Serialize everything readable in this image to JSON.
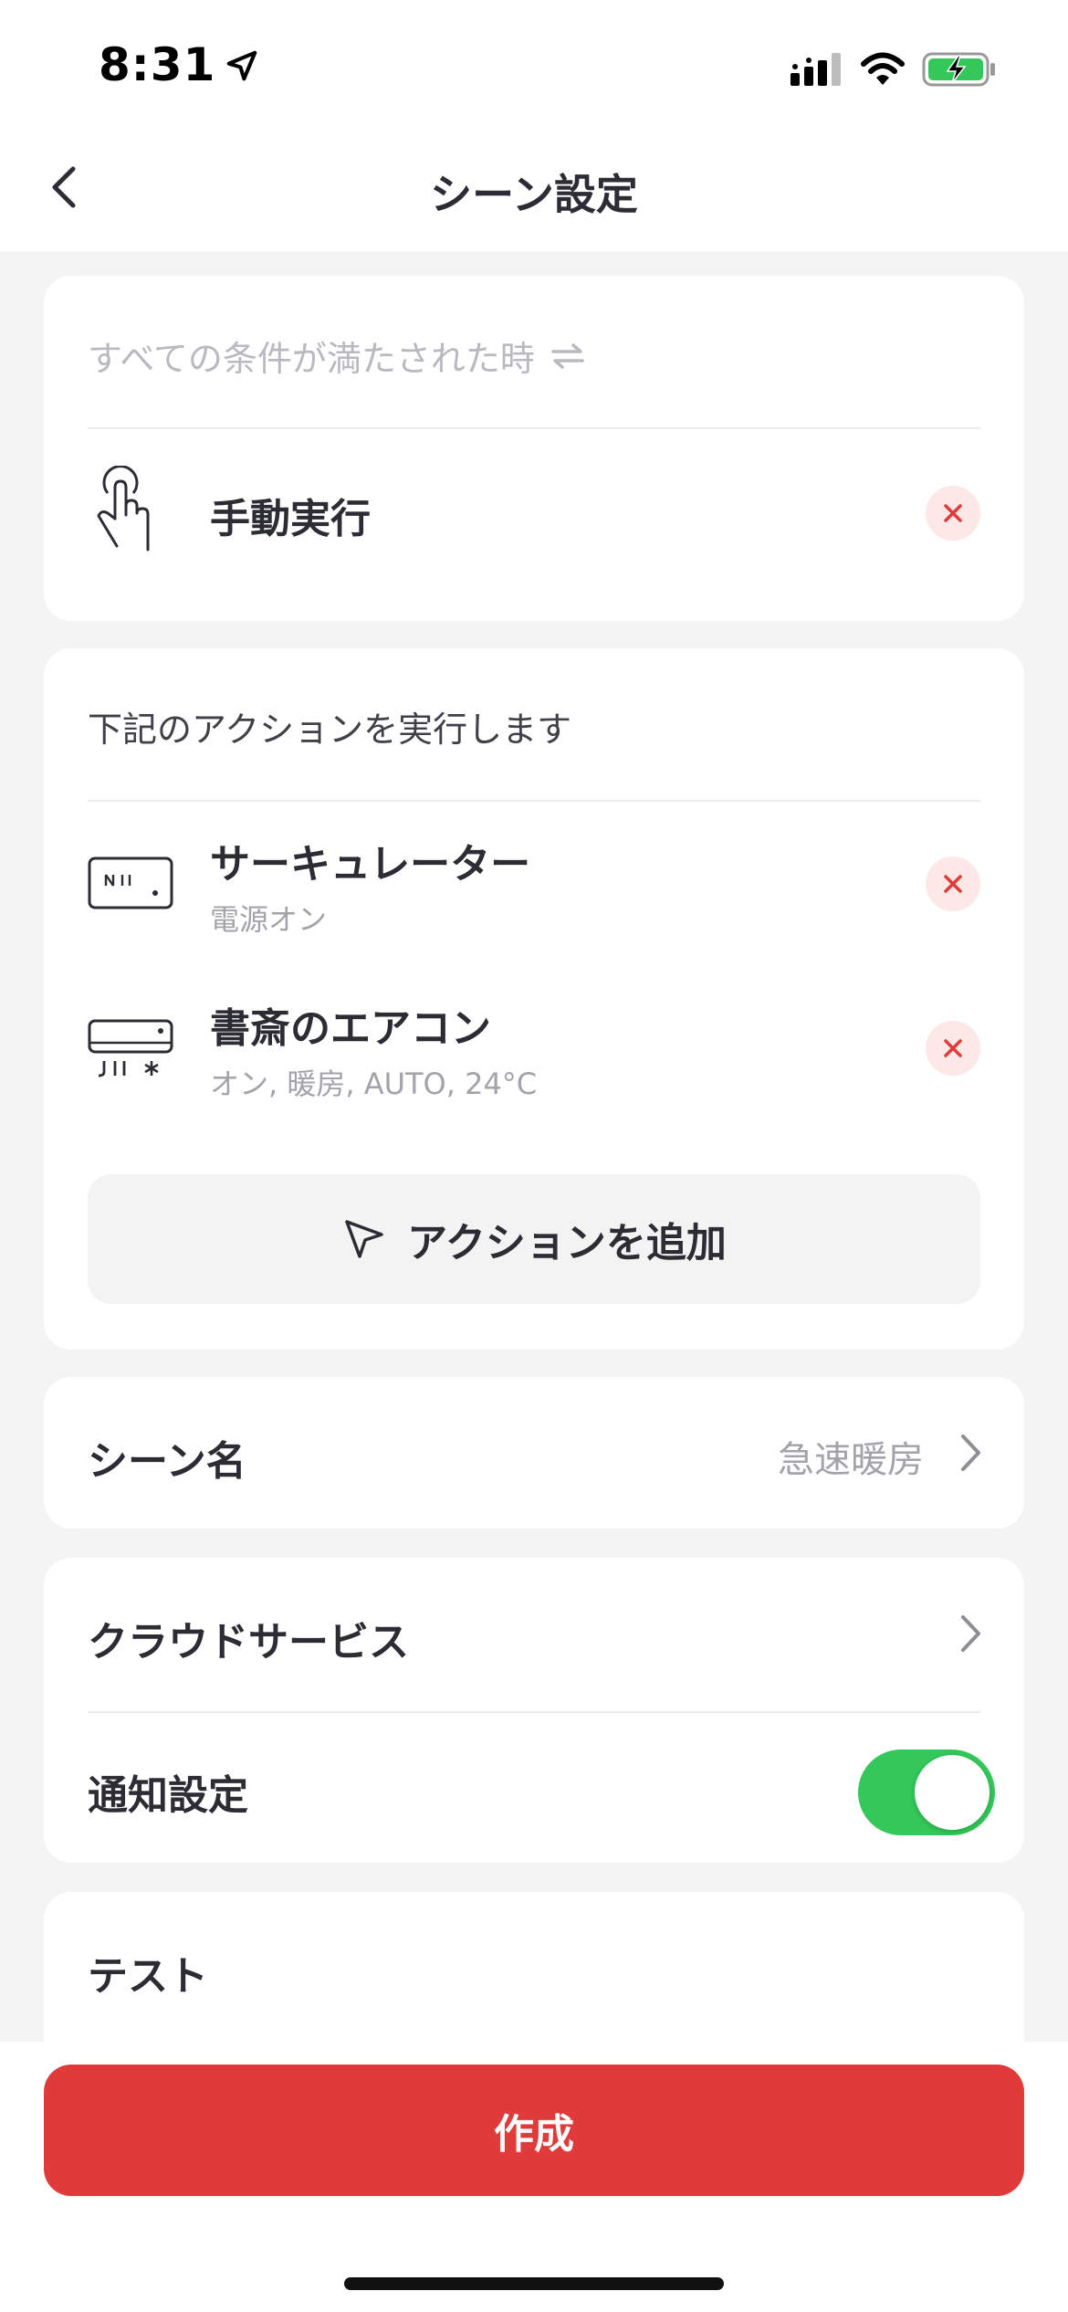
{
  "status": {
    "time": "8:31"
  },
  "nav": {
    "title": "シーン設定"
  },
  "condition": {
    "header": "すべての条件が満たされた時",
    "item_title": "手動実行"
  },
  "actions": {
    "header": "下記のアクションを実行します",
    "items": [
      {
        "title": "サーキュレーター",
        "subtitle": "電源オン"
      },
      {
        "title": "書斎のエアコン",
        "subtitle": "オン, 暖房, AUTO, 24°C"
      }
    ],
    "add_label": "アクションを追加"
  },
  "scene_name": {
    "label": "シーン名",
    "value": "急速暖房"
  },
  "cloud": {
    "label": "クラウドサービス"
  },
  "notification": {
    "label": "通知設定",
    "enabled": true
  },
  "test": {
    "label": "テスト"
  },
  "footer": {
    "create_label": "作成"
  },
  "colors": {
    "accent_red": "#e03a3a",
    "toggle_green": "#34c759",
    "remove_bg": "#fde8e8"
  }
}
